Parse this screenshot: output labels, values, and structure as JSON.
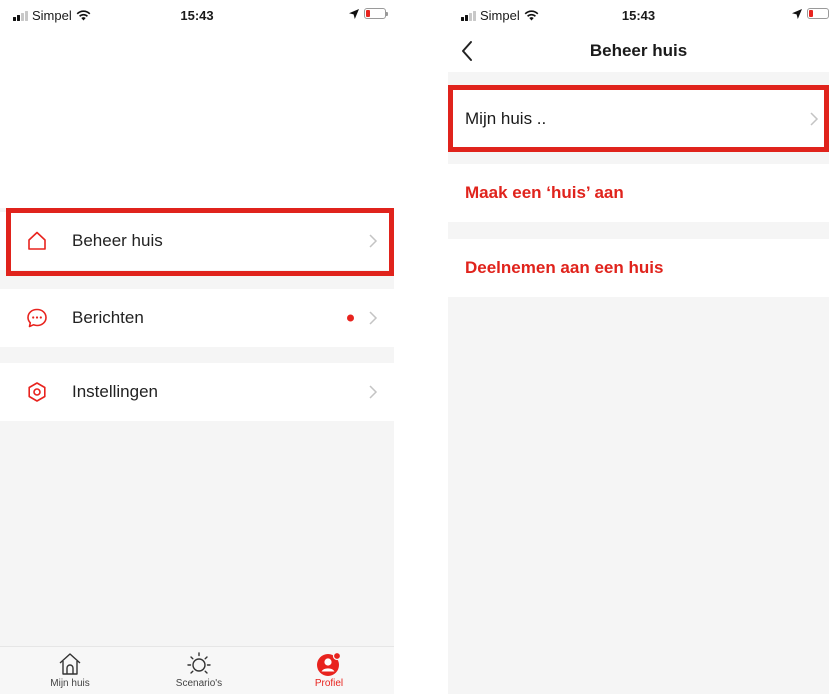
{
  "status": {
    "carrier": "Simpel",
    "time": "15:43"
  },
  "left": {
    "menu": [
      {
        "label": "Beheer huis",
        "icon": "house-outline-icon",
        "badge": false
      },
      {
        "label": "Berichten",
        "icon": "chat-bubble-icon",
        "badge": true
      },
      {
        "label": "Instellingen",
        "icon": "hexagon-settings-icon",
        "badge": false
      }
    ],
    "tabs": [
      {
        "label": "Mijn huis",
        "icon": "house-icon",
        "active": false
      },
      {
        "label": "Scenario's",
        "icon": "sun-icon",
        "active": false
      },
      {
        "label": "Profiel",
        "icon": "profile-icon",
        "active": true
      }
    ]
  },
  "right": {
    "title": "Beheer huis",
    "rows": [
      {
        "label": "Mijn huis .."
      },
      {
        "label": "Maak een ‘huis’ aan"
      },
      {
        "label": "Deelnemen aan een huis"
      }
    ]
  },
  "colors": {
    "accent": "#e8231e",
    "highlight": "#e0231c",
    "background": "#f5f5f5"
  }
}
